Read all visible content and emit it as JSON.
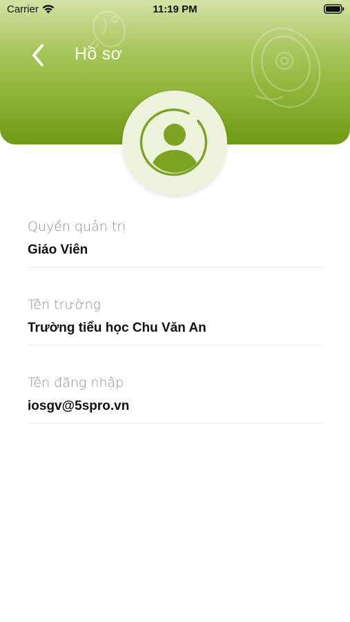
{
  "status_bar": {
    "carrier": "Carrier",
    "time": "11:19 PM",
    "wifi_icon": "wifi-icon",
    "battery_icon": "battery-icon"
  },
  "header": {
    "title": "Hồ sơ",
    "back_icon": "chevron-left-icon",
    "gradient_colors": [
      "#d3e2a6",
      "#8fb338",
      "#6f9a14"
    ]
  },
  "avatar": {
    "icon": "user-avatar-icon",
    "ring_color": "#7ea322",
    "background": "#eef3dd"
  },
  "profile_fields": [
    {
      "label": "Quyền quản trị",
      "value": "Giáo Viên"
    },
    {
      "label": "Tên trường",
      "value": "Trường tiểu học Chu Văn An"
    },
    {
      "label": "Tên đăng nhập",
      "value": "iosgv@5spro.vn"
    }
  ]
}
